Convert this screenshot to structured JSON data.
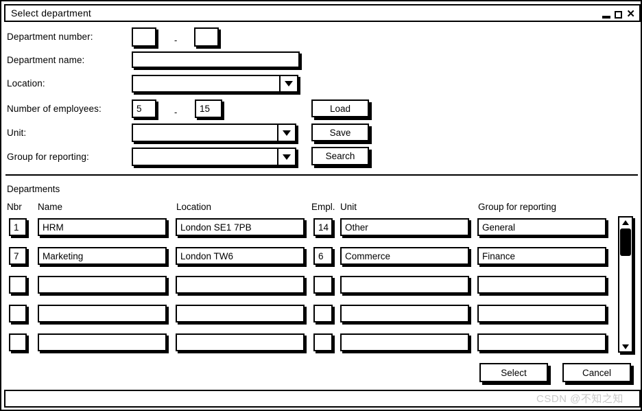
{
  "window": {
    "title": "Select department",
    "controls": {
      "minimize": "minimize",
      "maximize": "maximize",
      "close": "✕"
    }
  },
  "form": {
    "labels": {
      "department_number": "Department number:",
      "department_name": "Department name:",
      "location": "Location:",
      "number_of_employees": "Number of employees:",
      "unit": "Unit:",
      "group_for_reporting": "Group for reporting:"
    },
    "separator": "-",
    "values": {
      "department_number_from": "",
      "department_number_to": "",
      "department_name": "",
      "location": "",
      "employees_from": "5",
      "employees_to": "15",
      "unit": "",
      "group_for_reporting": ""
    }
  },
  "buttons": {
    "load": "Load",
    "save": "Save",
    "search": "Search",
    "select": "Select",
    "cancel": "Cancel"
  },
  "table": {
    "section_title": "Departments",
    "columns": [
      "Nbr",
      "Name",
      "Location",
      "Empl.",
      "Unit",
      "Group for reporting"
    ],
    "rows": [
      {
        "nbr": "1",
        "name": "HRM",
        "location": "London SE1 7PB",
        "empl": "14",
        "unit": "Other",
        "group": "General"
      },
      {
        "nbr": "7",
        "name": "Marketing",
        "location": "London TW6",
        "empl": "6",
        "unit": "Commerce",
        "group": "Finance"
      },
      {
        "nbr": "",
        "name": "",
        "location": "",
        "empl": "",
        "unit": "",
        "group": ""
      },
      {
        "nbr": "",
        "name": "",
        "location": "",
        "empl": "",
        "unit": "",
        "group": ""
      },
      {
        "nbr": "",
        "name": "",
        "location": "",
        "empl": "",
        "unit": "",
        "group": ""
      }
    ]
  },
  "watermark": "CSDN @不知之知",
  "colors": {
    "ink": "#000000",
    "background": "#ffffff",
    "watermark": "#c9c9c9"
  }
}
